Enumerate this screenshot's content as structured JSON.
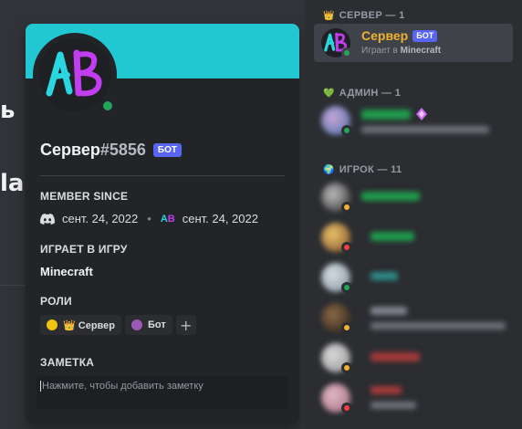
{
  "chat_fragments": [
    "ь",
    "la"
  ],
  "popout": {
    "username": "Сервер",
    "discriminator": "#5856",
    "bot_tag": "БОТ",
    "member_since_title": "MEMBER SINCE",
    "discord_since": "сент. 24, 2022",
    "server_since": "сент. 24, 2022",
    "avatar_text": "AB",
    "playing_title": "ИГРАЕТ В ИГРУ",
    "game": "Minecraft",
    "roles_title": "РОЛИ",
    "roles": [
      {
        "label": "👑 Сервер",
        "color": "#f1c40f"
      },
      {
        "label": "Бот",
        "color": "#9b59b6"
      }
    ],
    "add_role": "+",
    "note_title": "ЗАМЕТКА",
    "note_placeholder": "Нажмите, чтобы добавить заметку"
  },
  "member_list": {
    "groups": [
      {
        "icon": "👑",
        "title": "СЕРВЕР — 1"
      },
      {
        "icon": "💚",
        "title": "АДМИН — 1"
      },
      {
        "icon": "🌍",
        "title": "ИГРОК — 11"
      }
    ],
    "selected_member": {
      "name": "Сервер",
      "bot_tag": "БОТ",
      "activity_prefix": "Играет в",
      "activity_game": "Minecraft"
    }
  },
  "colors": {
    "banner": "#21c7d1",
    "online": "#23a55a",
    "idle": "#f0b232",
    "dnd": "#f23f43",
    "blurple": "#5865f2",
    "selected_name": "#f0b232"
  }
}
